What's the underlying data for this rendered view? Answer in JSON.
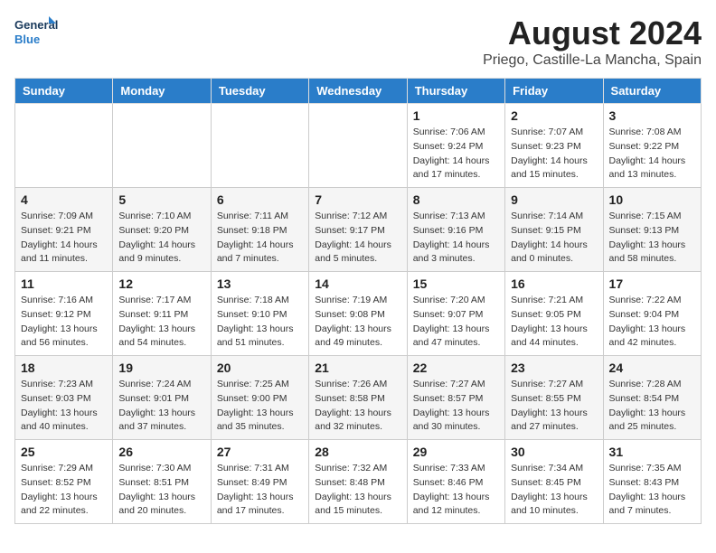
{
  "logo": {
    "line1": "General",
    "line2": "Blue"
  },
  "title": "August 2024",
  "subtitle": "Priego, Castille-La Mancha, Spain",
  "days_of_week": [
    "Sunday",
    "Monday",
    "Tuesday",
    "Wednesday",
    "Thursday",
    "Friday",
    "Saturday"
  ],
  "weeks": [
    [
      {
        "day": "",
        "info": ""
      },
      {
        "day": "",
        "info": ""
      },
      {
        "day": "",
        "info": ""
      },
      {
        "day": "",
        "info": ""
      },
      {
        "day": "1",
        "info": "Sunrise: 7:06 AM\nSunset: 9:24 PM\nDaylight: 14 hours\nand 17 minutes."
      },
      {
        "day": "2",
        "info": "Sunrise: 7:07 AM\nSunset: 9:23 PM\nDaylight: 14 hours\nand 15 minutes."
      },
      {
        "day": "3",
        "info": "Sunrise: 7:08 AM\nSunset: 9:22 PM\nDaylight: 14 hours\nand 13 minutes."
      }
    ],
    [
      {
        "day": "4",
        "info": "Sunrise: 7:09 AM\nSunset: 9:21 PM\nDaylight: 14 hours\nand 11 minutes."
      },
      {
        "day": "5",
        "info": "Sunrise: 7:10 AM\nSunset: 9:20 PM\nDaylight: 14 hours\nand 9 minutes."
      },
      {
        "day": "6",
        "info": "Sunrise: 7:11 AM\nSunset: 9:18 PM\nDaylight: 14 hours\nand 7 minutes."
      },
      {
        "day": "7",
        "info": "Sunrise: 7:12 AM\nSunset: 9:17 PM\nDaylight: 14 hours\nand 5 minutes."
      },
      {
        "day": "8",
        "info": "Sunrise: 7:13 AM\nSunset: 9:16 PM\nDaylight: 14 hours\nand 3 minutes."
      },
      {
        "day": "9",
        "info": "Sunrise: 7:14 AM\nSunset: 9:15 PM\nDaylight: 14 hours\nand 0 minutes."
      },
      {
        "day": "10",
        "info": "Sunrise: 7:15 AM\nSunset: 9:13 PM\nDaylight: 13 hours\nand 58 minutes."
      }
    ],
    [
      {
        "day": "11",
        "info": "Sunrise: 7:16 AM\nSunset: 9:12 PM\nDaylight: 13 hours\nand 56 minutes."
      },
      {
        "day": "12",
        "info": "Sunrise: 7:17 AM\nSunset: 9:11 PM\nDaylight: 13 hours\nand 54 minutes."
      },
      {
        "day": "13",
        "info": "Sunrise: 7:18 AM\nSunset: 9:10 PM\nDaylight: 13 hours\nand 51 minutes."
      },
      {
        "day": "14",
        "info": "Sunrise: 7:19 AM\nSunset: 9:08 PM\nDaylight: 13 hours\nand 49 minutes."
      },
      {
        "day": "15",
        "info": "Sunrise: 7:20 AM\nSunset: 9:07 PM\nDaylight: 13 hours\nand 47 minutes."
      },
      {
        "day": "16",
        "info": "Sunrise: 7:21 AM\nSunset: 9:05 PM\nDaylight: 13 hours\nand 44 minutes."
      },
      {
        "day": "17",
        "info": "Sunrise: 7:22 AM\nSunset: 9:04 PM\nDaylight: 13 hours\nand 42 minutes."
      }
    ],
    [
      {
        "day": "18",
        "info": "Sunrise: 7:23 AM\nSunset: 9:03 PM\nDaylight: 13 hours\nand 40 minutes."
      },
      {
        "day": "19",
        "info": "Sunrise: 7:24 AM\nSunset: 9:01 PM\nDaylight: 13 hours\nand 37 minutes."
      },
      {
        "day": "20",
        "info": "Sunrise: 7:25 AM\nSunset: 9:00 PM\nDaylight: 13 hours\nand 35 minutes."
      },
      {
        "day": "21",
        "info": "Sunrise: 7:26 AM\nSunset: 8:58 PM\nDaylight: 13 hours\nand 32 minutes."
      },
      {
        "day": "22",
        "info": "Sunrise: 7:27 AM\nSunset: 8:57 PM\nDaylight: 13 hours\nand 30 minutes."
      },
      {
        "day": "23",
        "info": "Sunrise: 7:27 AM\nSunset: 8:55 PM\nDaylight: 13 hours\nand 27 minutes."
      },
      {
        "day": "24",
        "info": "Sunrise: 7:28 AM\nSunset: 8:54 PM\nDaylight: 13 hours\nand 25 minutes."
      }
    ],
    [
      {
        "day": "25",
        "info": "Sunrise: 7:29 AM\nSunset: 8:52 PM\nDaylight: 13 hours\nand 22 minutes."
      },
      {
        "day": "26",
        "info": "Sunrise: 7:30 AM\nSunset: 8:51 PM\nDaylight: 13 hours\nand 20 minutes."
      },
      {
        "day": "27",
        "info": "Sunrise: 7:31 AM\nSunset: 8:49 PM\nDaylight: 13 hours\nand 17 minutes."
      },
      {
        "day": "28",
        "info": "Sunrise: 7:32 AM\nSunset: 8:48 PM\nDaylight: 13 hours\nand 15 minutes."
      },
      {
        "day": "29",
        "info": "Sunrise: 7:33 AM\nSunset: 8:46 PM\nDaylight: 13 hours\nand 12 minutes."
      },
      {
        "day": "30",
        "info": "Sunrise: 7:34 AM\nSunset: 8:45 PM\nDaylight: 13 hours\nand 10 minutes."
      },
      {
        "day": "31",
        "info": "Sunrise: 7:35 AM\nSunset: 8:43 PM\nDaylight: 13 hours\nand 7 minutes."
      }
    ]
  ]
}
